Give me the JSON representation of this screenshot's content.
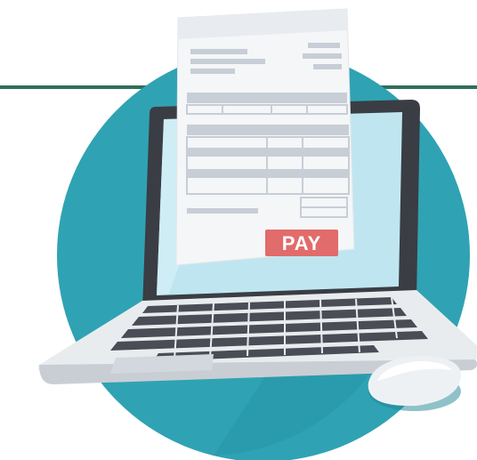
{
  "illustration": {
    "pay_button_label": "PAY"
  },
  "colors": {
    "header_line": "#2f6f5a",
    "circle": "#2fa3b3",
    "circle_shadow": "#1f8493",
    "laptop_bezel": "#3a3d44",
    "laptop_body": "#e9ecef",
    "screen": "#bfe6f0",
    "invoice_paper": "#f4f6f8",
    "invoice_lines": "#c7ced6",
    "pay_button": "#e26b6b",
    "keyboard_keys": "#4a4d55",
    "mouse": "#eef1f4"
  },
  "icons": {
    "main": "laptop-invoice-payment-icon",
    "mouse": "computer-mouse-icon"
  }
}
